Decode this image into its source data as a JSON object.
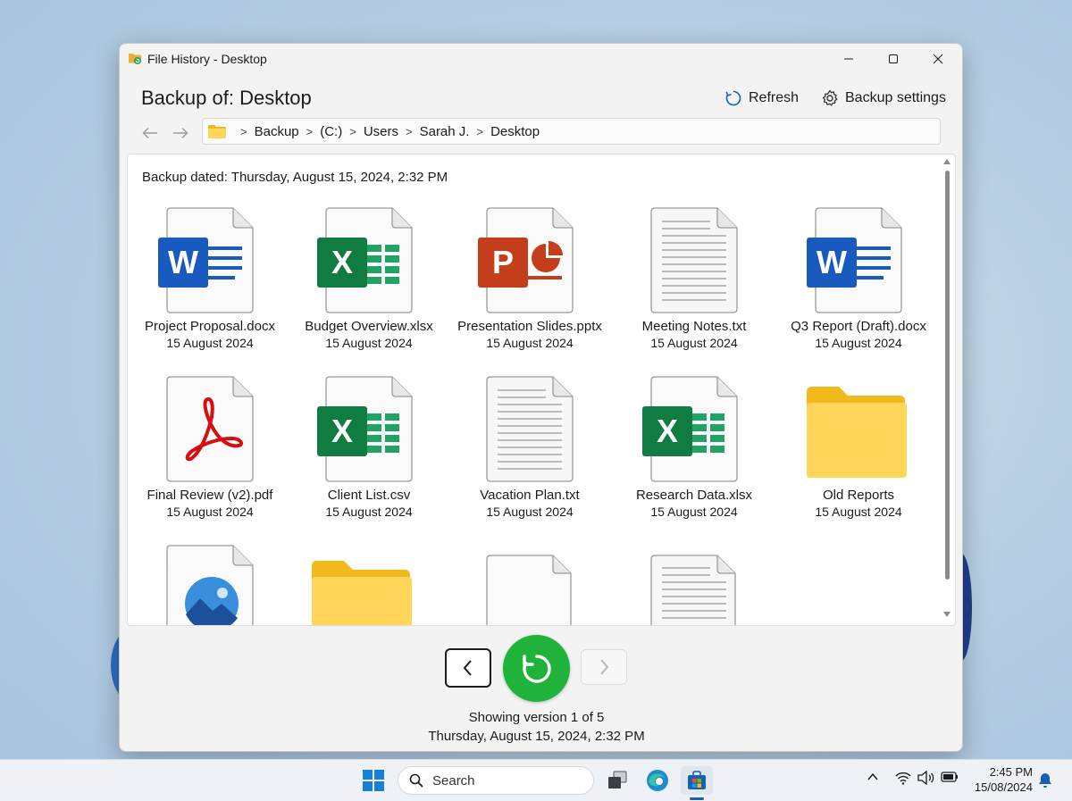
{
  "window": {
    "title": "File History - Desktop",
    "heading": "Backup of: Desktop",
    "refresh_label": "Refresh",
    "settings_label": "Backup settings"
  },
  "breadcrumb": [
    "Backup",
    "(C:)",
    "Users",
    "Sarah J.",
    "Desktop"
  ],
  "content": {
    "backup_dated": "Backup dated: Thursday, August 15, 2024, 2:32 PM",
    "items": [
      {
        "name": "Project Proposal.docx",
        "date": "15 August 2024",
        "icon": "word-icon"
      },
      {
        "name": "Budget Overview.xlsx",
        "date": "15 August 2024",
        "icon": "excel-icon"
      },
      {
        "name": "Presentation Slides.pptx",
        "date": "15 August 2024",
        "icon": "powerpoint-icon"
      },
      {
        "name": "Meeting Notes.txt",
        "date": "15 August 2024",
        "icon": "text-file-icon"
      },
      {
        "name": "Q3 Report (Draft).docx",
        "date": "15 August 2024",
        "icon": "word-icon"
      },
      {
        "name": "Final Review (v2).pdf",
        "date": "15 August 2024",
        "icon": "pdf-icon"
      },
      {
        "name": "Client List.csv",
        "date": "15 August 2024",
        "icon": "excel-icon"
      },
      {
        "name": "Vacation Plan.txt",
        "date": "15 August 2024",
        "icon": "text-file-icon"
      },
      {
        "name": "Research Data.xlsx",
        "date": "15 August 2024",
        "icon": "excel-icon"
      },
      {
        "name": "Old Reports",
        "date": "15 August 2024",
        "icon": "folder-icon"
      }
    ],
    "partial_items": [
      {
        "icon": "image-file-icon"
      },
      {
        "icon": "folder-icon"
      },
      {
        "icon": "blank-file-icon"
      },
      {
        "icon": "text-file-icon"
      }
    ]
  },
  "controls": {
    "version_status": "Showing version 1 of 5",
    "version_date": "Thursday, August 15, 2024, 2:32 PM"
  },
  "taskbar": {
    "search_placeholder": "Search",
    "time": "2:45 PM",
    "date": "15/08/2024"
  },
  "colors": {
    "restore_green": "#1fb33b",
    "word_blue": "#185abd",
    "excel_green": "#107c41",
    "powerpoint_orange": "#c43e1c",
    "pdf_red": "#d40f0f",
    "folder_yellow": "#ffd659"
  }
}
